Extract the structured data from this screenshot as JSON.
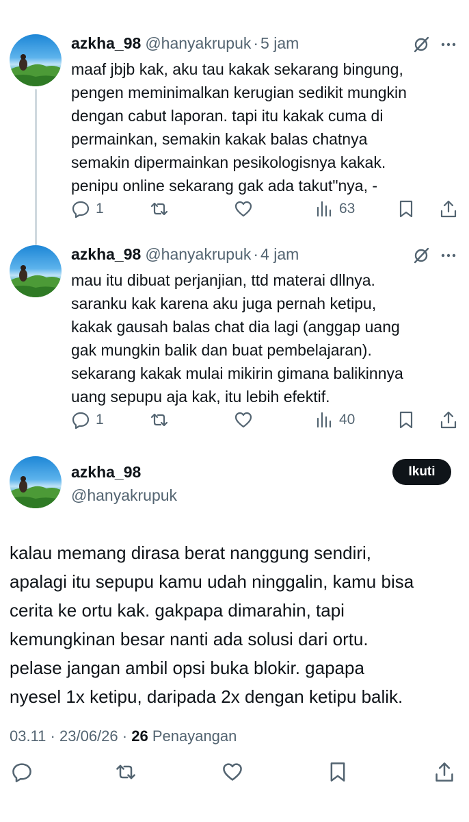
{
  "replies": [
    {
      "name": "azkha_98",
      "handle": "@hanyakrupuk",
      "separator": "·",
      "time": "5 jam",
      "text": "maaf jbjb kak, aku tau kakak sekarang bingung,\npengen meminimalkan kerugian sedikit mungkin\ndengan cabut laporan. tapi itu kakak cuma di\npermainkan, semakin kakak balas chatnya\nsemakin dipermainkan pesikologisnya kakak.\npenipu online sekarang gak ada takut\"nya, -",
      "reply_count": "1",
      "views": "63"
    },
    {
      "name": "azkha_98",
      "handle": "@hanyakrupuk",
      "separator": "·",
      "time": "4 jam",
      "text": "mau itu dibuat perjanjian, ttd materai dllnya.\nsaranku kak karena aku juga pernah ketipu,\nkakak gausah balas chat dia lagi (anggap uang\ngak mungkin balik dan buat pembelajaran).\nsekarang kakak mulai mikirin gimana balikinnya\nuang sepupu aja kak, itu lebih efektif.",
      "reply_count": "1",
      "views": "40"
    }
  ],
  "main": {
    "name": "azkha_98",
    "handle": "@hanyakrupuk",
    "follow_label": "Ikuti",
    "text": "kalau memang dirasa berat nanggung sendiri,\napalagi itu sepupu kamu udah ninggalin, kamu bisa\ncerita ke ortu kak. gakpapa dimarahin, tapi\nkemungkinan besar nanti ada solusi dari ortu.\npelase jangan ambil opsi buka blokir. gapapa\nnyesel 1x ketipu, daripada 2x dengan ketipu balik.",
    "time": "03.11",
    "date": "23/06/26",
    "views_count": "26",
    "views_label": "Penayangan",
    "separator": "·"
  },
  "icons": {
    "reply": "reply-icon",
    "retweet": "retweet-icon",
    "like": "heart-icon",
    "views": "views-icon",
    "bookmark": "bookmark-icon",
    "share": "share-icon",
    "grok": "grok-icon",
    "more": "more-icon"
  },
  "colors": {
    "text": "#0f1419",
    "secondary": "#536471",
    "thread_line": "#cfd9de",
    "follow_bg": "#0f1419"
  }
}
